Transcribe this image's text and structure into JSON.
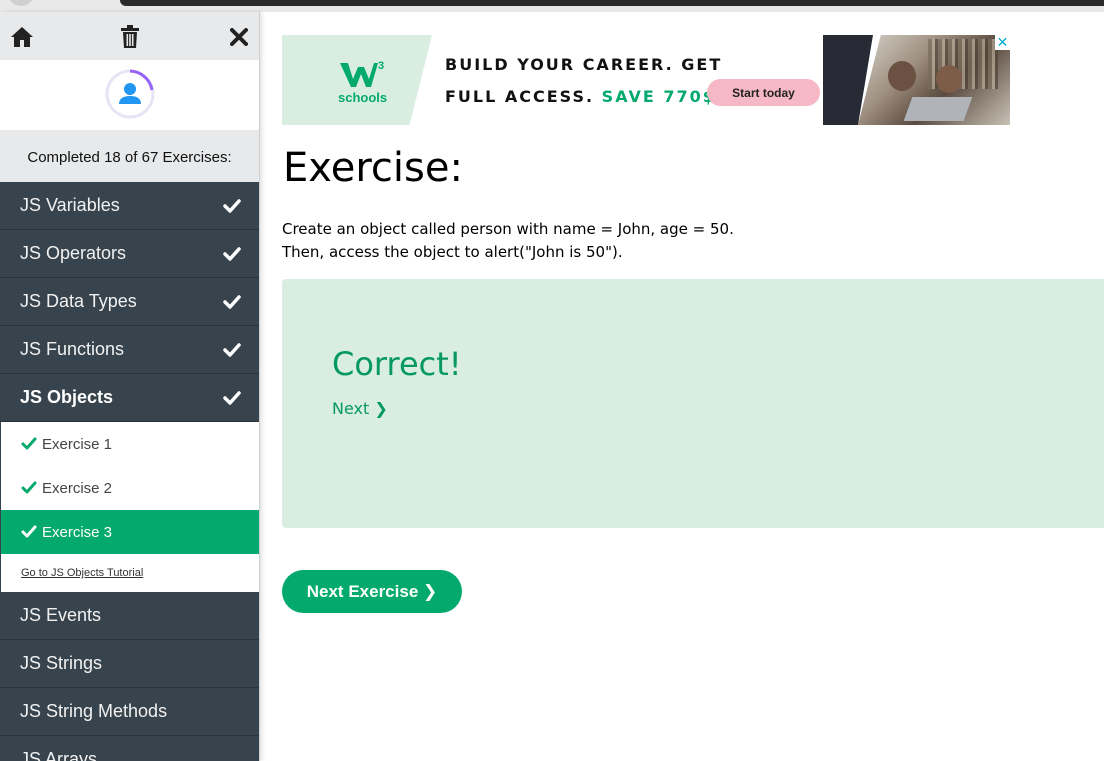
{
  "toolbar": {
    "home_icon": "home-icon",
    "trash_icon": "trash-icon",
    "close_icon": "close-icon"
  },
  "progress": {
    "text": "Completed 18 of 67 Exercises:",
    "completed": 18,
    "total": 67
  },
  "menu": {
    "top_items": [
      {
        "label": "JS Variables",
        "done": true
      },
      {
        "label": "JS Operators",
        "done": true
      },
      {
        "label": "JS Data Types",
        "done": true
      },
      {
        "label": "JS Functions",
        "done": true
      },
      {
        "label": "JS Objects",
        "done": true
      }
    ],
    "sub_items": [
      {
        "label": "Exercise 1",
        "done": true
      },
      {
        "label": "Exercise 2",
        "done": true
      },
      {
        "label": "Exercise 3",
        "done": true,
        "current": true
      }
    ],
    "tutorial_link": "Go to JS Objects Tutorial",
    "bottom_items": [
      {
        "label": "JS Events"
      },
      {
        "label": "JS Strings"
      },
      {
        "label": "JS String Methods"
      },
      {
        "label": "JS Arrays"
      }
    ]
  },
  "ad": {
    "logo_text": "schools",
    "line1": "BUILD YOUR CAREER. GET",
    "line2_prefix": "FULL ACCESS.",
    "line2_highlight": "SAVE 770$",
    "button": "Start today",
    "close": "✕"
  },
  "main": {
    "title": "Exercise:",
    "instruction_line1": "Create an object called person with name = John, age = 50.",
    "instruction_line2": "Then, access the object to alert(\"John is 50\").",
    "result_title": "Correct!",
    "next_link": "Next ❯",
    "next_button": "Next Exercise ❯"
  },
  "colors": {
    "accent": "#04aa6d",
    "sidebar_bg": "#38444d",
    "result_bg": "#d9eee1"
  }
}
